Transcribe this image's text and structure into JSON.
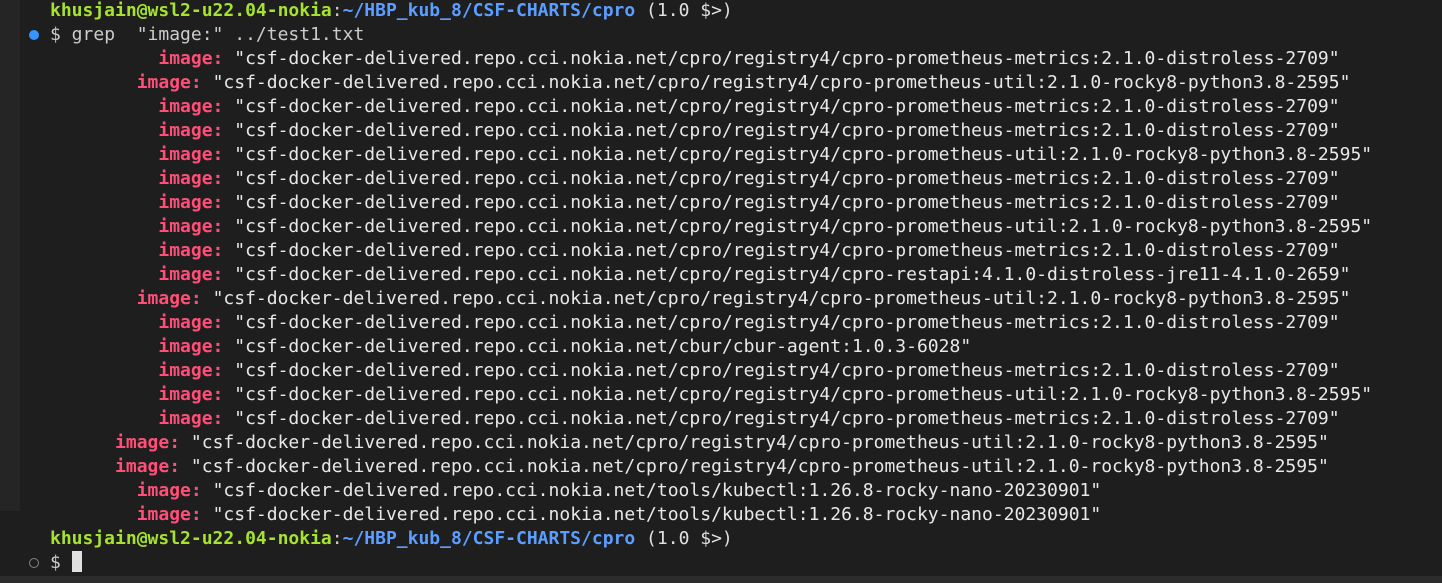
{
  "prompt": {
    "user_host": "khusjain@wsl2-u22.04-nokia",
    "colon": ":",
    "cwd": "~/HBP_kub_8/CSF-CHARTS/cpro",
    "branch": " (1.0 $>)"
  },
  "command": {
    "dollar": "$",
    "text": " grep  \"image:\" ../test1.txt"
  },
  "output": [
    {
      "indent": "          ",
      "key": "image:",
      "value": " \"csf-docker-delivered.repo.cci.nokia.net/cpro/registry4/cpro-prometheus-metrics:2.1.0-distroless-2709\""
    },
    {
      "indent": "        ",
      "key": "image:",
      "value": " \"csf-docker-delivered.repo.cci.nokia.net/cpro/registry4/cpro-prometheus-util:2.1.0-rocky8-python3.8-2595\""
    },
    {
      "indent": "          ",
      "key": "image:",
      "value": " \"csf-docker-delivered.repo.cci.nokia.net/cpro/registry4/cpro-prometheus-metrics:2.1.0-distroless-2709\""
    },
    {
      "indent": "          ",
      "key": "image:",
      "value": " \"csf-docker-delivered.repo.cci.nokia.net/cpro/registry4/cpro-prometheus-metrics:2.1.0-distroless-2709\""
    },
    {
      "indent": "          ",
      "key": "image:",
      "value": " \"csf-docker-delivered.repo.cci.nokia.net/cpro/registry4/cpro-prometheus-util:2.1.0-rocky8-python3.8-2595\""
    },
    {
      "indent": "          ",
      "key": "image:",
      "value": " \"csf-docker-delivered.repo.cci.nokia.net/cpro/registry4/cpro-prometheus-metrics:2.1.0-distroless-2709\""
    },
    {
      "indent": "          ",
      "key": "image:",
      "value": " \"csf-docker-delivered.repo.cci.nokia.net/cpro/registry4/cpro-prometheus-metrics:2.1.0-distroless-2709\""
    },
    {
      "indent": "          ",
      "key": "image:",
      "value": " \"csf-docker-delivered.repo.cci.nokia.net/cpro/registry4/cpro-prometheus-util:2.1.0-rocky8-python3.8-2595\""
    },
    {
      "indent": "          ",
      "key": "image:",
      "value": " \"csf-docker-delivered.repo.cci.nokia.net/cpro/registry4/cpro-prometheus-metrics:2.1.0-distroless-2709\""
    },
    {
      "indent": "          ",
      "key": "image:",
      "value": " \"csf-docker-delivered.repo.cci.nokia.net/cpro/registry4/cpro-restapi:4.1.0-distroless-jre11-4.1.0-2659\""
    },
    {
      "indent": "        ",
      "key": "image:",
      "value": " \"csf-docker-delivered.repo.cci.nokia.net/cpro/registry4/cpro-prometheus-util:2.1.0-rocky8-python3.8-2595\""
    },
    {
      "indent": "          ",
      "key": "image:",
      "value": " \"csf-docker-delivered.repo.cci.nokia.net/cpro/registry4/cpro-prometheus-metrics:2.1.0-distroless-2709\""
    },
    {
      "indent": "          ",
      "key": "image:",
      "value": " \"csf-docker-delivered.repo.cci.nokia.net/cbur/cbur-agent:1.0.3-6028\""
    },
    {
      "indent": "          ",
      "key": "image:",
      "value": " \"csf-docker-delivered.repo.cci.nokia.net/cpro/registry4/cpro-prometheus-metrics:2.1.0-distroless-2709\""
    },
    {
      "indent": "          ",
      "key": "image:",
      "value": " \"csf-docker-delivered.repo.cci.nokia.net/cpro/registry4/cpro-prometheus-util:2.1.0-rocky8-python3.8-2595\""
    },
    {
      "indent": "          ",
      "key": "image:",
      "value": " \"csf-docker-delivered.repo.cci.nokia.net/cpro/registry4/cpro-prometheus-metrics:2.1.0-distroless-2709\""
    },
    {
      "indent": "      ",
      "key": "image:",
      "value": " \"csf-docker-delivered.repo.cci.nokia.net/cpro/registry4/cpro-prometheus-util:2.1.0-rocky8-python3.8-2595\""
    },
    {
      "indent": "      ",
      "key": "image:",
      "value": " \"csf-docker-delivered.repo.cci.nokia.net/cpro/registry4/cpro-prometheus-util:2.1.0-rocky8-python3.8-2595\""
    },
    {
      "indent": "        ",
      "key": "image:",
      "value": " \"csf-docker-delivered.repo.cci.nokia.net/tools/kubectl:1.26.8-rocky-nano-20230901\""
    },
    {
      "indent": "        ",
      "key": "image:",
      "value": " \"csf-docker-delivered.repo.cci.nokia.net/tools/kubectl:1.26.8-rocky-nano-20230901\""
    }
  ],
  "next_prompt": {
    "user_host": "khusjain@wsl2-u22.04-nokia",
    "colon": ":",
    "cwd": "~/HBP_kub_8/CSF-CHARTS/cpro",
    "branch": " (1.0 $>)",
    "dollar": "$ "
  },
  "colors": {
    "background": "#1e1e1e",
    "user_host": "#a6e22e",
    "cwd": "#5c9eff",
    "image_key": "#ff4f78",
    "success_decoration": "#3794ff"
  },
  "icons": {
    "command_status": "command-success-circle-icon",
    "empty_command": "command-empty-circle-icon"
  }
}
